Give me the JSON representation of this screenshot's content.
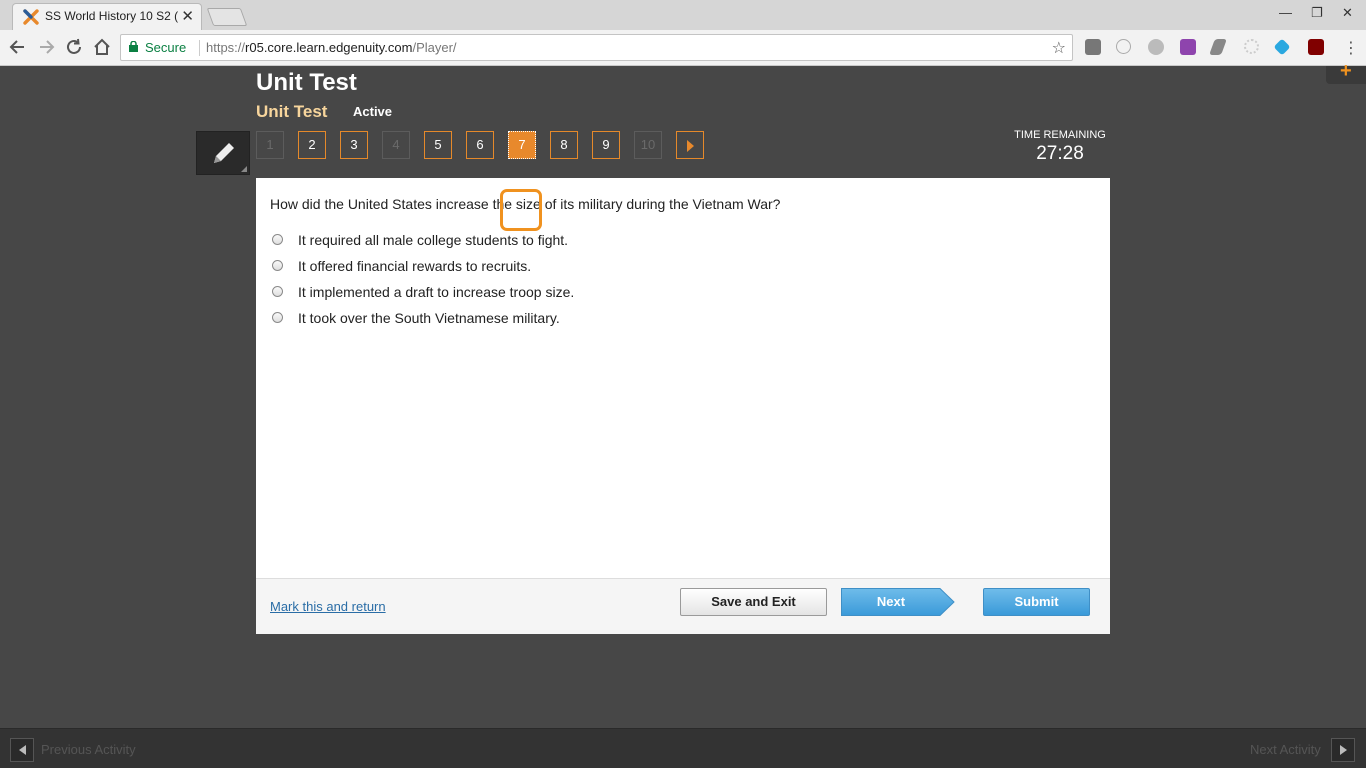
{
  "browser": {
    "tab_title": "SS World History 10 S2 (",
    "omnibox": {
      "secure_label": "Secure",
      "url_scheme": "https://",
      "url_host": "r05.core.learn.edgenuity.com",
      "url_path": "/Player/"
    },
    "window_controls": {
      "minimize": "—",
      "restore": "❐",
      "close": "✕"
    }
  },
  "player": {
    "title": "Unit Test",
    "subtitle": "Unit Test",
    "status": "Active",
    "question_nav": [
      {
        "label": "1",
        "state": "disabled"
      },
      {
        "label": "2",
        "state": "normal"
      },
      {
        "label": "3",
        "state": "normal"
      },
      {
        "label": "4",
        "state": "disabled"
      },
      {
        "label": "5",
        "state": "normal"
      },
      {
        "label": "6",
        "state": "normal"
      },
      {
        "label": "7",
        "state": "current"
      },
      {
        "label": "8",
        "state": "normal"
      },
      {
        "label": "9",
        "state": "normal"
      },
      {
        "label": "10",
        "state": "disabled"
      }
    ],
    "timer": {
      "label": "TIME REMAINING",
      "value": "27:28"
    },
    "question": {
      "text": "How did the United States increase the size of its military during the Vietnam War?",
      "options": [
        "It required all male college students to fight.",
        "It offered financial rewards to recruits.",
        "It implemented a draft to increase troop size.",
        "It took over the South Vietnamese military."
      ]
    },
    "footer": {
      "mark_link": "Mark this and return",
      "save_exit": "Save and Exit",
      "next": "Next",
      "submit": "Submit"
    }
  },
  "activity_bar": {
    "previous": "Previous Activity",
    "next": "Next Activity"
  },
  "colors": {
    "accent_orange": "#e8892c",
    "button_blue": "#3a9ad9",
    "background": "#474747"
  }
}
